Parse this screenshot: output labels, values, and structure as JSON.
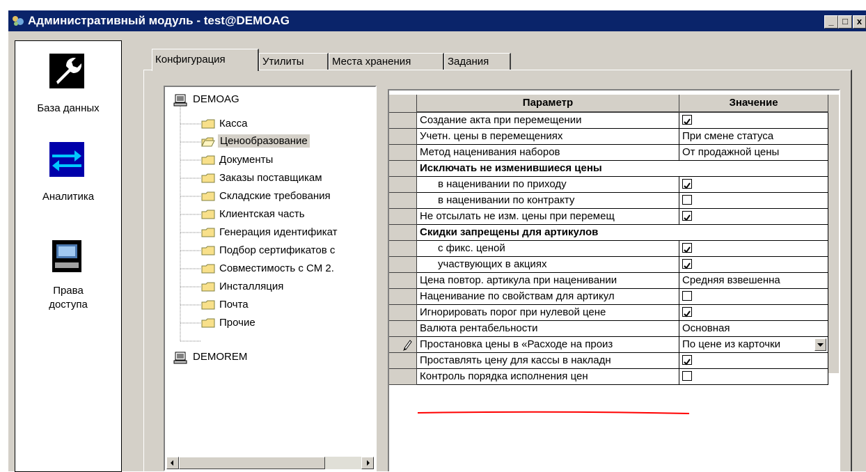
{
  "window": {
    "title": "Административный модуль - test@DEMOAG",
    "minimize_label": "_",
    "maximize_label": "□",
    "close_label": "x"
  },
  "nav": {
    "items": [
      {
        "label": "База данных",
        "icon": "wrench-icon"
      },
      {
        "label": "Аналитика",
        "icon": "arrows-exchange-icon"
      },
      {
        "label": "Права доступа",
        "icon": "computer-icon"
      }
    ]
  },
  "tabs": [
    {
      "label": "Конфигурация",
      "active": true
    },
    {
      "label": "Утилиты",
      "active": false
    },
    {
      "label": "Места хранения",
      "active": false
    },
    {
      "label": "Задания",
      "active": false
    }
  ],
  "tree": {
    "root1": "DEMOAG",
    "children": [
      "Касса",
      "Ценообразование",
      "Документы",
      "Заказы поставщикам",
      "Складские требования",
      "Клиентская часть",
      "Генерация идентификат",
      "Подбор сертификатов с",
      "Совместимость с СМ 2.",
      "Инсталляция",
      "Почта",
      "Прочие"
    ],
    "selected": "Ценообразование",
    "root2": "DEMOREM"
  },
  "grid": {
    "headers": {
      "param": "Параметр",
      "value": "Значение"
    },
    "rows": [
      {
        "param": "Создание акта при перемещении",
        "value": "",
        "check": true
      },
      {
        "param": "Учетн. цены в перемещениях",
        "value": "При смене статуса"
      },
      {
        "param": "Метод наценивания наборов",
        "value": "От продажной цены"
      },
      {
        "param": "Исключать не изменившиеся цены",
        "value": "",
        "group": true
      },
      {
        "param": "в наценивании по приходу",
        "value": "",
        "check": true,
        "indent": true
      },
      {
        "param": "в наценивании по контракту",
        "value": "",
        "check": false,
        "indent": true
      },
      {
        "param": "Не отсылать не изм. цены при перемещ",
        "value": "",
        "check": true
      },
      {
        "param": "Скидки запрещены для артикулов",
        "value": "",
        "group": true
      },
      {
        "param": "с фикс. ценой",
        "value": "",
        "check": true,
        "indent": true
      },
      {
        "param": "участвующих в акциях",
        "value": "",
        "check": true,
        "indent": true
      },
      {
        "param": "Цена повтор. артикула при наценивании",
        "value": "Средняя взвешенна"
      },
      {
        "param": "Наценивание по свойствам для артикул",
        "value": "",
        "check": false
      },
      {
        "param": "Игнорировать порог при нулевой цене",
        "value": "",
        "check": true
      },
      {
        "param": "Валюта рентабельности",
        "value": "Основная"
      },
      {
        "param": "Простановка цены в «Расходе на произ",
        "value": "По цене из карточки",
        "editing": true
      },
      {
        "param": "Проставлять цену для кассы в накладн",
        "value": "",
        "check": true
      },
      {
        "param": "Контроль порядка исполнения цен",
        "value": "",
        "check": false
      }
    ]
  },
  "colors": {
    "titlebar": "#0a246a",
    "face": "#d4d0c8",
    "underline": "#ff0000"
  }
}
